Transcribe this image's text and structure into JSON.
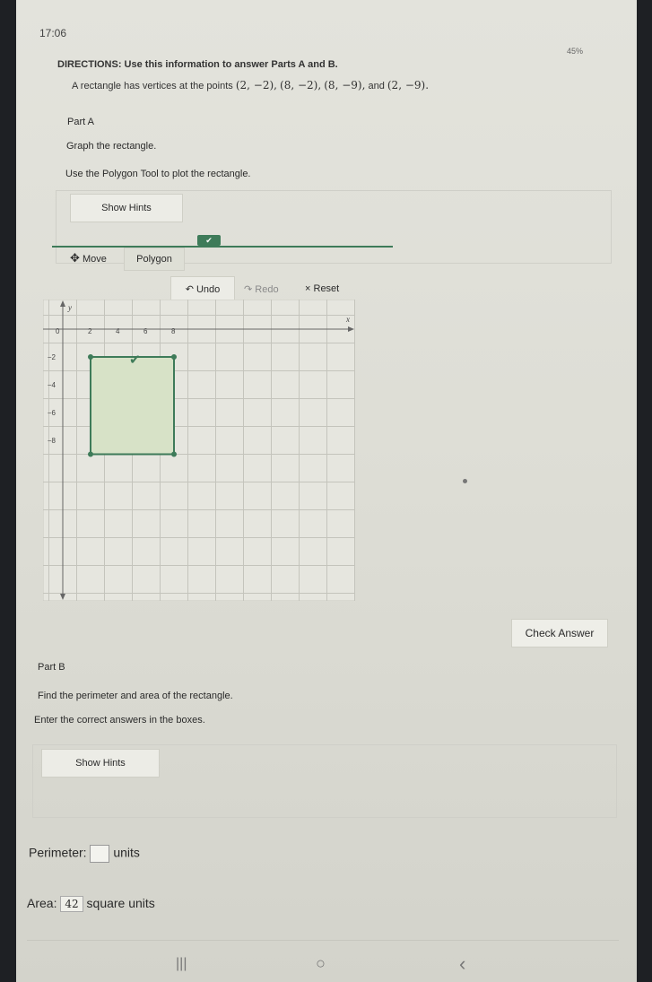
{
  "status": {
    "time": "17:06",
    "icons_text": "45%"
  },
  "directions": "DIRECTIONS: Use this information to answer Parts A and B.",
  "problem": {
    "lead": "A rectangle has vertices at the points",
    "p1": "(2, −2),",
    "p2": "(8, −2),",
    "p3": "(8, −9),",
    "and": "and",
    "p4": "(2, −9)."
  },
  "partA": {
    "label": "Part A",
    "instruction": "Graph the rectangle.",
    "tool_instruction": "Use the Polygon Tool to plot the rectangle.",
    "show_hints": "Show Hints"
  },
  "toolbar": {
    "move": "Move",
    "polygon": "Polygon",
    "undo": "Undo",
    "redo": "Redo",
    "reset": "Reset",
    "checkmark": "✔"
  },
  "graph": {
    "x_label": "x",
    "y_label": "y",
    "x_ticks": [
      "0",
      "2",
      "4",
      "6",
      "8"
    ],
    "y_ticks": [
      "−2",
      "−4",
      "−6",
      "−8"
    ],
    "rectangle_vertices": [
      [
        2,
        -2
      ],
      [
        8,
        -2
      ],
      [
        8,
        -9
      ],
      [
        2,
        -9
      ]
    ],
    "fill_color": "#d7e2c7",
    "stroke_color": "#3e7b59"
  },
  "check_answer": "Check Answer",
  "partB": {
    "label": "Part B",
    "instruction": "Find the perimeter and area of the rectangle.",
    "enter": "Enter the correct answers in the boxes.",
    "show_hints": "Show Hints",
    "perimeter_label": "Perimeter:",
    "perimeter_value": "",
    "perimeter_units": "units",
    "area_label": "Area:",
    "area_value": "42",
    "area_units": "square units"
  },
  "navbar": {
    "recent": "|||",
    "home": "○",
    "back": "‹"
  }
}
